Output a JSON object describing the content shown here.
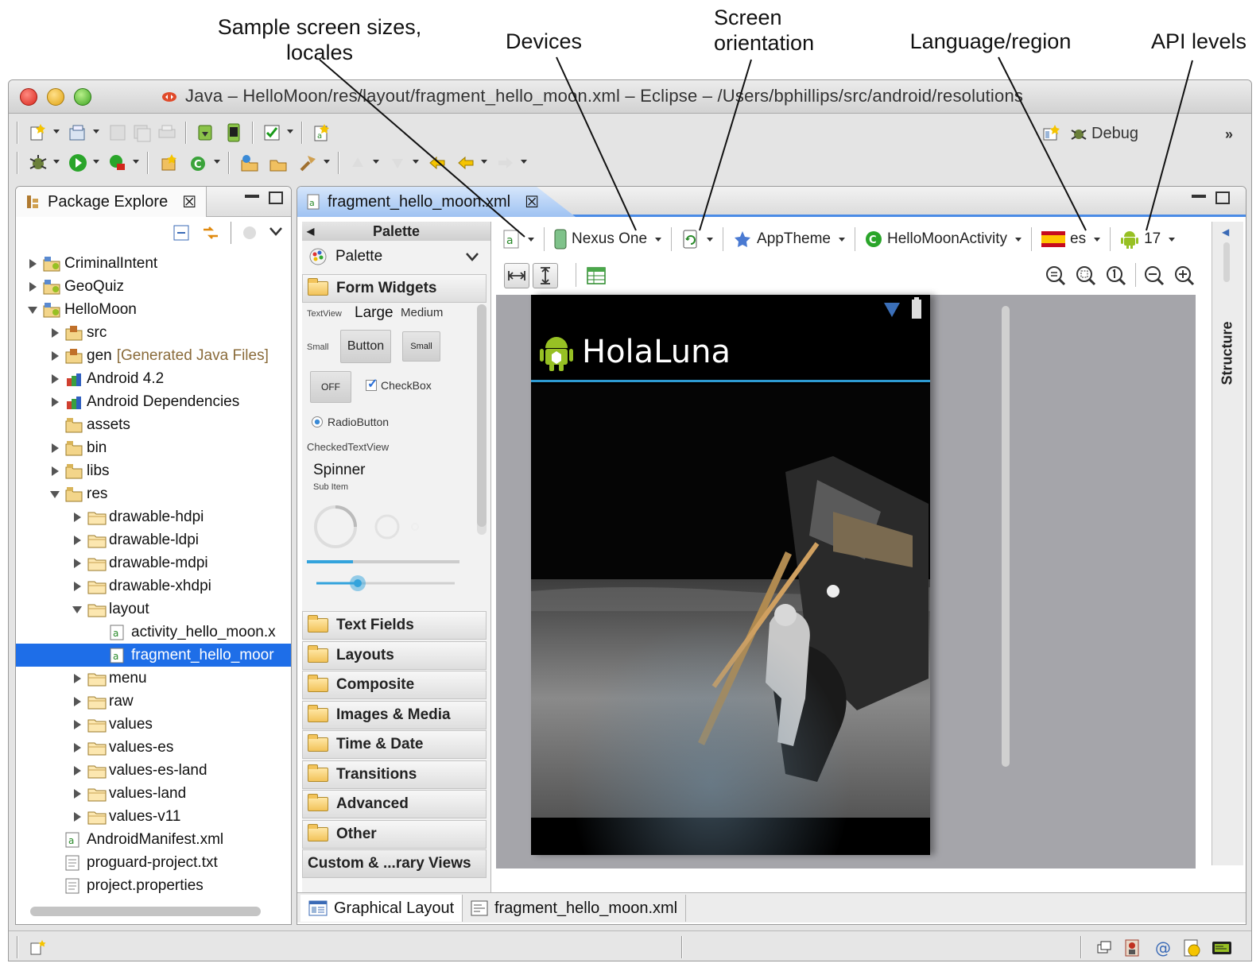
{
  "callouts": {
    "sample_sizes": "Sample screen sizes,",
    "sample_sizes_2": "locales",
    "devices": "Devices",
    "orientation": "Screen",
    "orientation_2": "orientation",
    "language": "Language/region",
    "api": "API levels"
  },
  "window": {
    "title": "Java – HelloMoon/res/layout/fragment_hello_moon.xml – Eclipse – /Users/bphillips/src/android/resolutions"
  },
  "perspective": {
    "debug_label": "Debug",
    "more": "»"
  },
  "package_explorer": {
    "tab_label": "Package Explore",
    "close": "☒",
    "items": [
      {
        "label": "CriminalIntent",
        "indent": 0,
        "twisty": "closed",
        "icon": "project-icon"
      },
      {
        "label": "GeoQuiz",
        "indent": 0,
        "twisty": "closed",
        "icon": "project-icon"
      },
      {
        "label": "HelloMoon",
        "indent": 0,
        "twisty": "open",
        "icon": "project-icon"
      },
      {
        "label": "src",
        "indent": 1,
        "twisty": "closed",
        "icon": "source-folder-icon"
      },
      {
        "label": "gen",
        "suffix": "[Generated Java Files]",
        "indent": 1,
        "twisty": "closed",
        "icon": "source-folder-icon"
      },
      {
        "label": "Android 4.2",
        "indent": 1,
        "twisty": "closed",
        "icon": "library-icon"
      },
      {
        "label": "Android Dependencies",
        "indent": 1,
        "twisty": "closed",
        "icon": "library-icon"
      },
      {
        "label": "assets",
        "indent": 1,
        "twisty": "none",
        "icon": "package-folder-icon"
      },
      {
        "label": "bin",
        "indent": 1,
        "twisty": "closed",
        "icon": "package-folder-icon"
      },
      {
        "label": "libs",
        "indent": 1,
        "twisty": "closed",
        "icon": "package-folder-icon"
      },
      {
        "label": "res",
        "indent": 1,
        "twisty": "open",
        "icon": "package-folder-icon"
      },
      {
        "label": "drawable-hdpi",
        "indent": 2,
        "twisty": "closed",
        "icon": "folder-icon"
      },
      {
        "label": "drawable-ldpi",
        "indent": 2,
        "twisty": "closed",
        "icon": "folder-icon"
      },
      {
        "label": "drawable-mdpi",
        "indent": 2,
        "twisty": "closed",
        "icon": "folder-icon"
      },
      {
        "label": "drawable-xhdpi",
        "indent": 2,
        "twisty": "closed",
        "icon": "folder-icon"
      },
      {
        "label": "layout",
        "indent": 2,
        "twisty": "open",
        "icon": "folder-icon"
      },
      {
        "label": "activity_hello_moon.x",
        "indent": 3,
        "twisty": "none",
        "icon": "xml-file-icon"
      },
      {
        "label": "fragment_hello_moor",
        "indent": 3,
        "twisty": "none",
        "icon": "xml-file-icon",
        "selected": true
      },
      {
        "label": "menu",
        "indent": 2,
        "twisty": "closed",
        "icon": "folder-icon"
      },
      {
        "label": "raw",
        "indent": 2,
        "twisty": "closed",
        "icon": "folder-icon"
      },
      {
        "label": "values",
        "indent": 2,
        "twisty": "closed",
        "icon": "folder-icon"
      },
      {
        "label": "values-es",
        "indent": 2,
        "twisty": "closed",
        "icon": "folder-icon"
      },
      {
        "label": "values-es-land",
        "indent": 2,
        "twisty": "closed",
        "icon": "folder-icon"
      },
      {
        "label": "values-land",
        "indent": 2,
        "twisty": "closed",
        "icon": "folder-icon"
      },
      {
        "label": "values-v11",
        "indent": 2,
        "twisty": "closed",
        "icon": "folder-icon"
      },
      {
        "label": "AndroidManifest.xml",
        "indent": 1,
        "twisty": "none",
        "icon": "xml-file-icon"
      },
      {
        "label": "proguard-project.txt",
        "indent": 1,
        "twisty": "none",
        "icon": "text-file-icon"
      },
      {
        "label": "project.properties",
        "indent": 1,
        "twisty": "none",
        "icon": "text-file-icon"
      }
    ]
  },
  "editor": {
    "tab_label": "fragment_hello_moon.xml",
    "close": "☒",
    "palette": {
      "header": "Palette",
      "selector": "Palette",
      "categories": [
        "Form Widgets",
        "Text Fields",
        "Layouts",
        "Composite",
        "Images & Media",
        "Time & Date",
        "Transitions",
        "Advanced",
        "Other",
        "Custom & ...rary Views"
      ],
      "widgets": {
        "textview": "TextView",
        "large": "Large",
        "medium": "Medium",
        "small_label": "Small",
        "button": "Button",
        "small_button": "Small",
        "toggle_off": "OFF",
        "checkbox": "CheckBox",
        "radio": "RadioButton",
        "checked_text": "CheckedTextView",
        "spinner": "Spinner",
        "sub_item": "Sub Item"
      }
    },
    "layout_toolbar": {
      "device": "Nexus One",
      "theme": "AppTheme",
      "activity": "HelloMoonActivity",
      "locale": "es",
      "api_level": "17"
    },
    "preview": {
      "app_title": "HolaLuna"
    },
    "structure_label": "Structure",
    "bottom_tabs": [
      "Graphical Layout",
      "fragment_hello_moon.xml"
    ]
  }
}
